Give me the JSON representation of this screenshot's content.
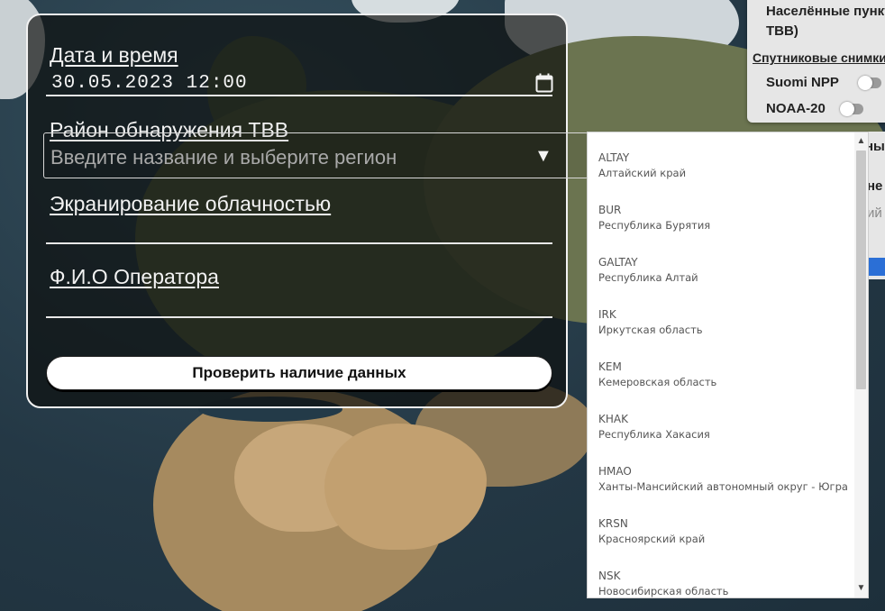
{
  "form": {
    "datetime_label": "Дата и время",
    "datetime_value": "30.05.2023 12:00",
    "region_label": "Район обнаружения ТВВ",
    "region_placeholder": "Введите название и выберите регион",
    "cloud_label": "Экранирование облачностью",
    "operator_label": "Ф.И.О Оператора",
    "check_button": "Проверить наличие данных"
  },
  "layers": {
    "settlements_line1": "Населённые пункты",
    "settlements_line2": "ТВВ)",
    "satellite_section": "Спутниковые снимки",
    "sat1": "Suomi NPP",
    "sat2": "NOAA-20",
    "frag1": "ны",
    "frag2": "не",
    "frag3": "ий"
  },
  "regions": [
    {
      "code": "ALTAY",
      "name": "Алтайский край"
    },
    {
      "code": "BUR",
      "name": "Республика Бурятия"
    },
    {
      "code": "GALTAY",
      "name": "Республика Алтай"
    },
    {
      "code": "IRK",
      "name": "Иркутская область"
    },
    {
      "code": "KEM",
      "name": "Кемеровская область"
    },
    {
      "code": "KHAK",
      "name": "Республика Хакасия"
    },
    {
      "code": "HMAO",
      "name": "Ханты-Мансийский автономный округ - Югра"
    },
    {
      "code": "KRSN",
      "name": "Красноярский край"
    },
    {
      "code": "NSK",
      "name": "Новосибирская область"
    }
  ]
}
